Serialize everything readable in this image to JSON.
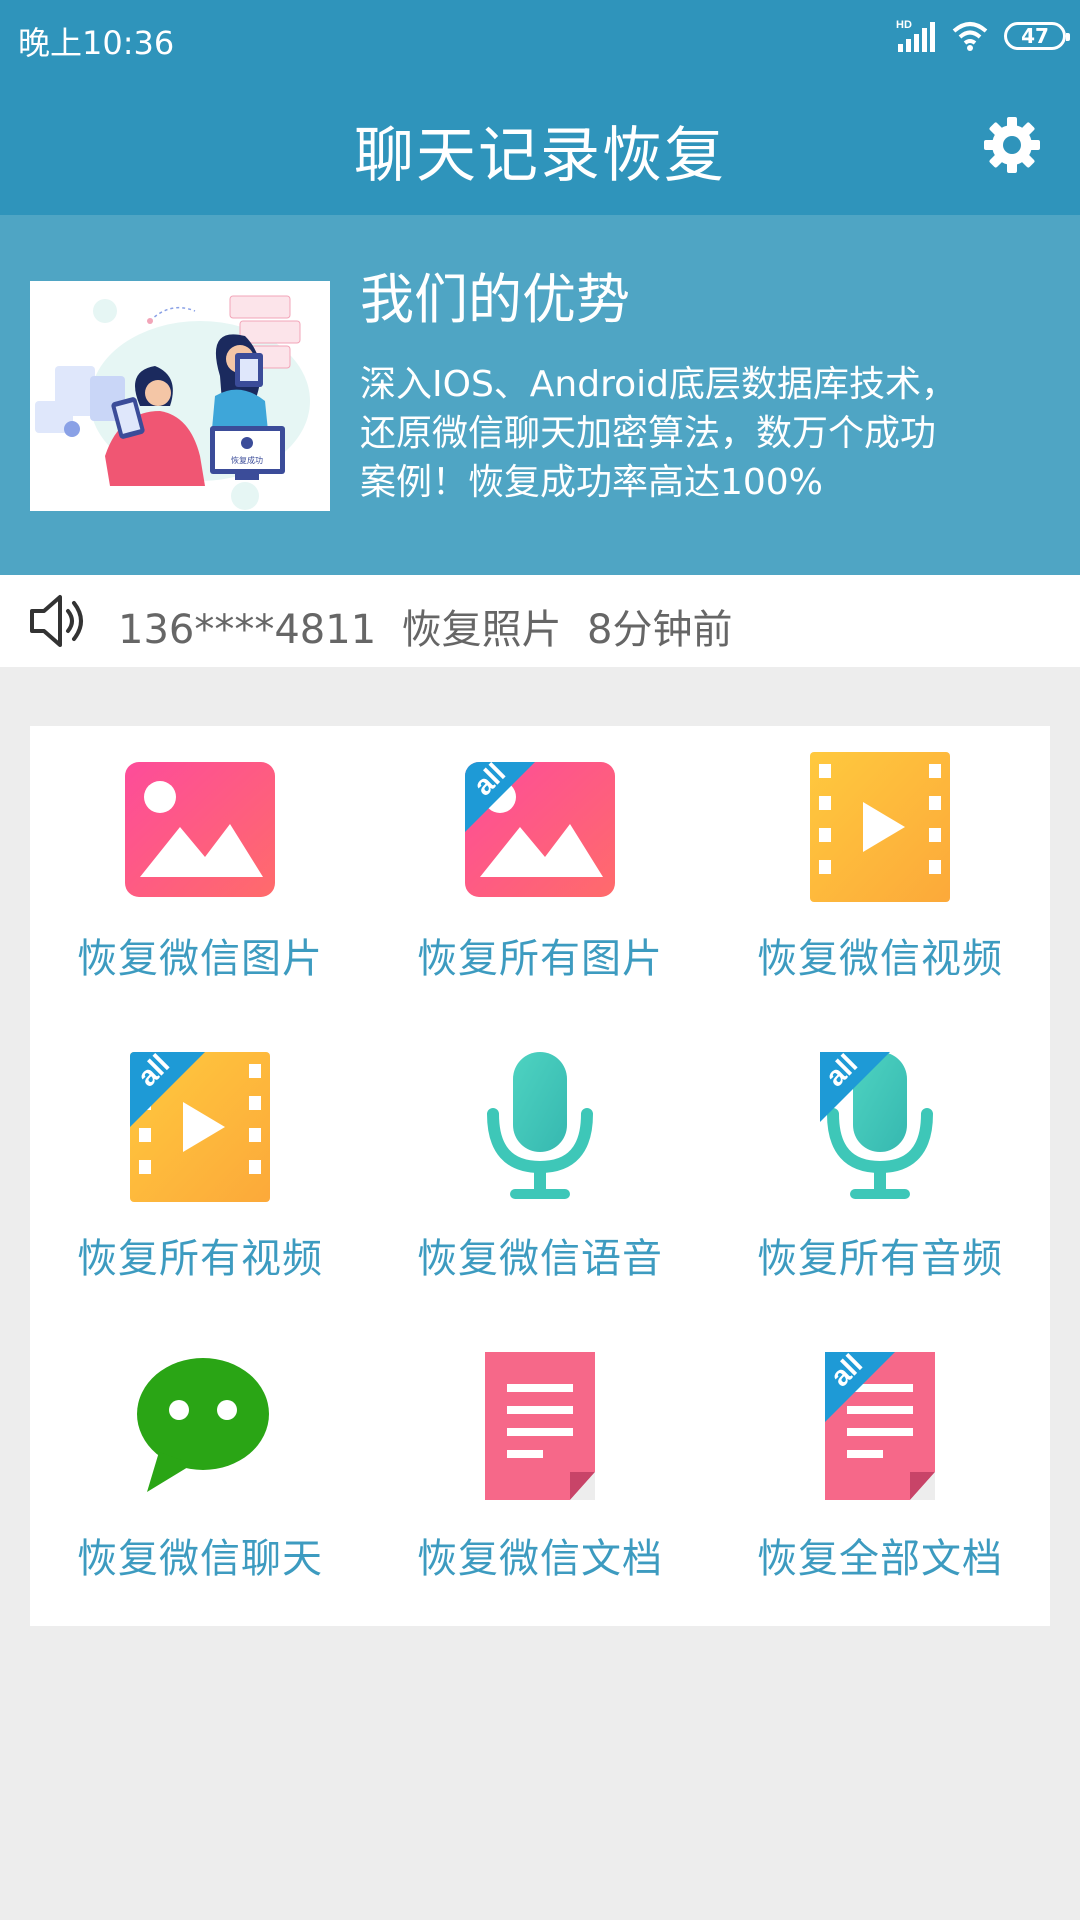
{
  "status_bar": {
    "time": "晚上10:36",
    "network_label": "HD",
    "battery": "47"
  },
  "app_bar": {
    "title": "聊天记录恢复",
    "settings_icon": "gear-icon"
  },
  "banner": {
    "title": "我们的优势",
    "description_lines": [
      "深入IOS、Android底层数据库技术，",
      "还原微信聊天加密算法，数万个成功",
      "案例！恢复成功率高达100%"
    ],
    "illustration_badge": "恢复成功"
  },
  "notice": {
    "icon": "speaker-icon",
    "phone": "136****4811",
    "action": "恢复照片",
    "time": "8分钟前"
  },
  "colors": {
    "primary": "#2f94bb",
    "banner": "#4fa5c4",
    "label": "#3d9bc0",
    "pink": "#f55c7f",
    "orange": "#fdb33c",
    "teal": "#3ec7b8",
    "green": "#2aa515"
  },
  "grid": {
    "tiles": [
      {
        "label": "恢复微信图片",
        "icon": "image-icon"
      },
      {
        "label": "恢复所有图片",
        "icon": "image-all-icon",
        "badge": "all"
      },
      {
        "label": "恢复微信视频",
        "icon": "video-icon"
      },
      {
        "label": "恢复所有视频",
        "icon": "video-all-icon",
        "badge": "all"
      },
      {
        "label": "恢复微信语音",
        "icon": "microphone-icon"
      },
      {
        "label": "恢复所有音频",
        "icon": "microphone-all-icon",
        "badge": "all"
      },
      {
        "label": "恢复微信聊天",
        "icon": "wechat-chat-icon"
      },
      {
        "label": "恢复微信文档",
        "icon": "document-icon"
      },
      {
        "label": "恢复全部文档",
        "icon": "document-all-icon",
        "badge": "all"
      }
    ]
  }
}
